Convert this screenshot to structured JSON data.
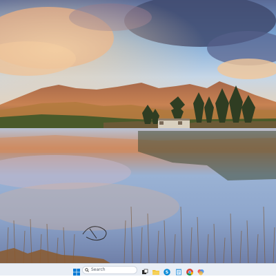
{
  "wallpaper": {
    "icon": "lake-mountain-sunset-wallpaper"
  },
  "taskbar": {
    "start_icon": "windows-start-icon",
    "search": {
      "placeholder": "Search",
      "icon": "search-icon"
    },
    "pinned": [
      {
        "name": "task-view-icon"
      },
      {
        "name": "file-explorer-icon"
      },
      {
        "name": "skype-icon"
      },
      {
        "name": "notepad-icon"
      },
      {
        "name": "chrome-icon"
      },
      {
        "name": "photos-icon"
      }
    ],
    "accent": "#0078d4"
  }
}
